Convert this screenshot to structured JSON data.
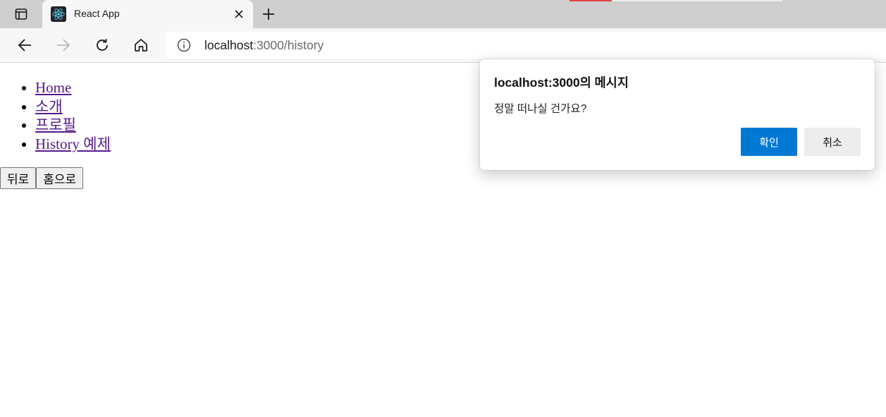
{
  "browser": {
    "tab": {
      "title": "React App",
      "favicon": "react-logo-icon"
    },
    "url_host": "localhost",
    "url_path": ":3000/history",
    "icons": {
      "tab_actions": "tab-actions-icon",
      "close": "close-icon",
      "new_tab": "plus-icon",
      "back": "back-arrow-icon",
      "forward": "forward-arrow-icon",
      "reload": "reload-icon",
      "home": "home-icon",
      "site_info": "info-icon"
    }
  },
  "page": {
    "nav": [
      {
        "label": "Home"
      },
      {
        "label": "소개"
      },
      {
        "label": "프로필"
      },
      {
        "label": "History 예제"
      }
    ],
    "buttons": {
      "back": "뒤로",
      "home": "홈으로"
    },
    "colors": {
      "visited_link": "#551a8b"
    }
  },
  "dialog": {
    "title": "localhost:3000의 메시지",
    "message": "정말 떠나실 건가요?",
    "ok_label": "확인",
    "cancel_label": "취소",
    "colors": {
      "primary": "#0078d4"
    }
  }
}
